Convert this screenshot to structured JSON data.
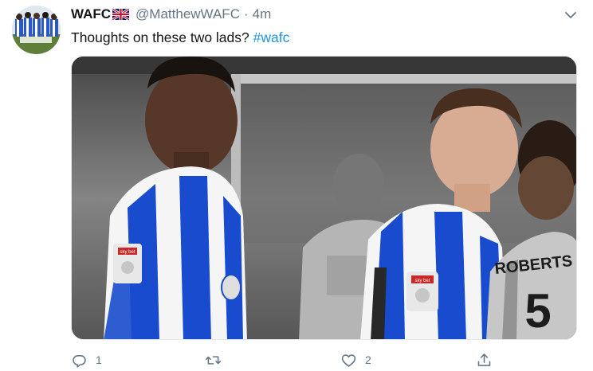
{
  "tweet": {
    "display_name": "WAFC",
    "flag_icon": "uk-flag-icon",
    "handle": "@MatthewWAFC",
    "separator": "·",
    "time": "4m",
    "text": "Thoughts on these two lads?",
    "hashtag": "#wafc",
    "jersey_name": "ROBERTS",
    "badge_text": "sky bet"
  },
  "actions": {
    "reply_count": "1",
    "retweet_count": "",
    "like_count": "2"
  },
  "colors": {
    "link": "#1b95e0",
    "secondary_text": "#657786",
    "kit_blue": "#1a4fd6"
  }
}
